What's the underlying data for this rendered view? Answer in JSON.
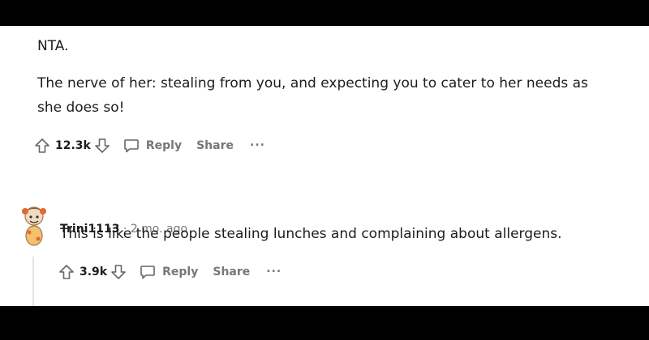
{
  "comment1": {
    "verdict": "NTA.",
    "body_line1": "The nerve of her: stealing from you, and expecting you to cater to her needs as",
    "body_line2": "she does so!",
    "votes": "12.3k",
    "reply_label": "Reply",
    "share_label": "Share",
    "more_label": "..."
  },
  "comment2": {
    "username": "Trini1113",
    "separator": "·",
    "age": "2 mo. ago",
    "body": "This is like the people stealing lunches and complaining about allergens.",
    "votes": "3.9k",
    "reply_label": "Reply",
    "share_label": "Share",
    "more_label": "..."
  }
}
